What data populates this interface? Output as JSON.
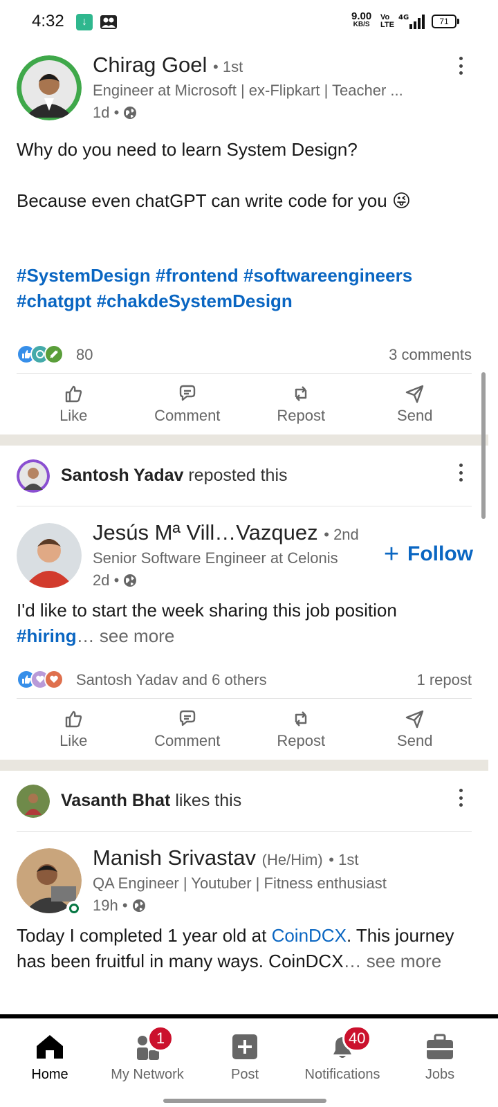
{
  "status_bar": {
    "time": "4:32",
    "net_speed": "9.00",
    "net_unit": "KB/S",
    "volte_top": "Vo",
    "volte_bottom": "LTE",
    "network": "4G",
    "battery": "71"
  },
  "posts": [
    {
      "author": {
        "name": "Chirag Goel",
        "degree": "• 1st",
        "headline": "Engineer at Microsoft | ex-Flipkart | Teacher ...",
        "time": "1d •"
      },
      "body_line1": "Why do you need to learn System Design?",
      "body_line2": "Because even chatGPT can write code for you 😜",
      "hashtags_line1": "#SystemDesign #frontend #softwareengineers",
      "hashtags_line2": "#chatgpt #chakdeSystemDesign",
      "reaction_count": "80",
      "comments": "3 comments",
      "actions": [
        "Like",
        "Comment",
        "Repost",
        "Send"
      ]
    },
    {
      "context_name": "Santosh Yadav",
      "context_action": "reposted this",
      "author": {
        "name": "Jesús Mª Vill…Vazquez",
        "degree": "• 2nd",
        "headline": "Senior Software Engineer at Celonis",
        "time": "2d •"
      },
      "follow_label": "Follow",
      "body_text": "I'd like to start the week sharing this job position",
      "body_hashtag": "#hiring",
      "body_ellipsis": "…",
      "see_more": "see more",
      "reactions_text": "Santosh Yadav and 6 others",
      "reposts": "1 repost",
      "actions": [
        "Like",
        "Comment",
        "Repost",
        "Send"
      ]
    },
    {
      "context_name": "Vasanth Bhat",
      "context_action": "likes this",
      "author": {
        "name": "Manish Srivastav",
        "pronouns": "(He/Him)",
        "degree": "• 1st",
        "headline": "QA Engineer | Youtuber | Fitness enthusiast",
        "time": "19h •"
      },
      "body_text1": "Today I completed 1 year old at",
      "body_link": "CoinDCX",
      "body_text2": ". This journey",
      "body_text3": "has been fruitful in many ways. CoinDCX",
      "body_ellipsis": "…",
      "see_more": "see more"
    }
  ],
  "bottom_nav": {
    "items": [
      "Home",
      "My Network",
      "Post",
      "Notifications",
      "Jobs"
    ],
    "network_badge": "1",
    "notifications_badge": "40",
    "active": "Home"
  },
  "colors": {
    "link": "#0a66c2",
    "badge": "#cb112d",
    "divider": "#e9e6df",
    "online": "#057642"
  }
}
